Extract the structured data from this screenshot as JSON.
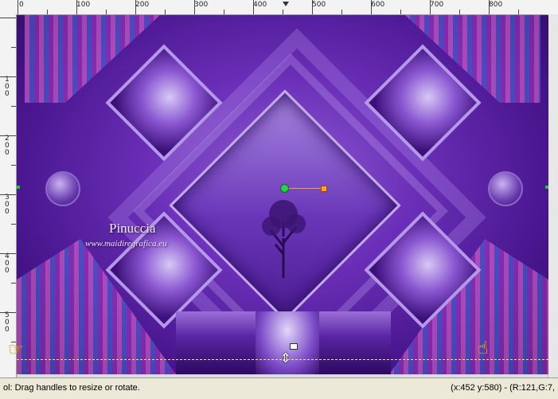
{
  "ruler": {
    "top_labels": [
      "0",
      "100",
      "200",
      "300",
      "400",
      "500",
      "600",
      "700",
      "800"
    ],
    "left_labels": [
      "1\n0\n0",
      "2\n0\n0",
      "3\n0\n0",
      "4\n0\n0",
      "5\n0\n0"
    ]
  },
  "canvas": {
    "watermark_title": "Pinuccia",
    "watermark_url": "www.maidiregrafica.eu"
  },
  "statusbar": {
    "hint": "ol: Drag handles to resize or rotate.",
    "coords": "(x:452 y:580) - (R:121,G:7,"
  }
}
